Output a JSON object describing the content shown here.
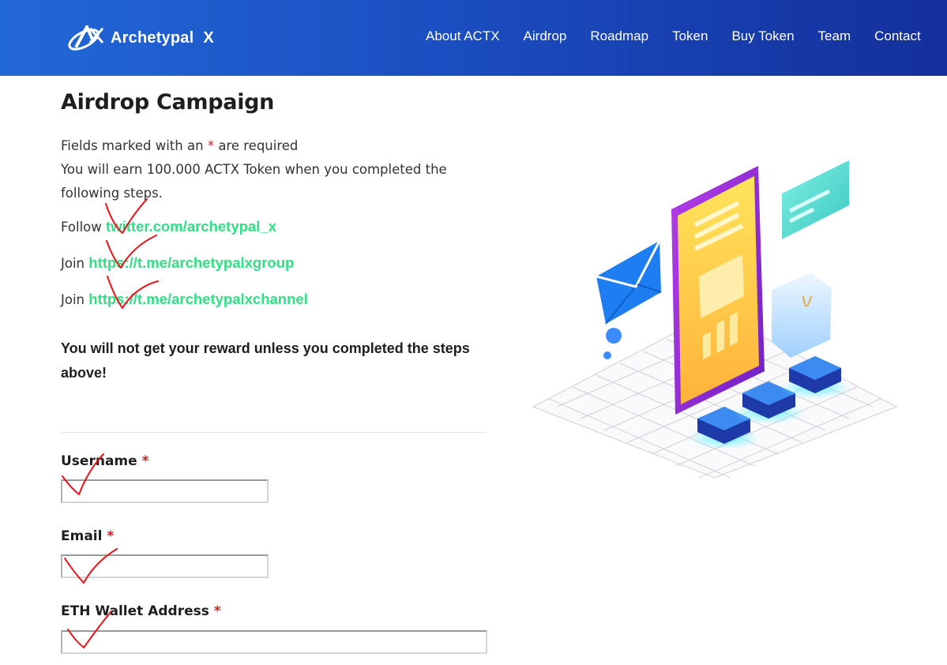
{
  "header": {
    "logo_text": "Archetypal",
    "logo_suffix": "X",
    "nav": [
      {
        "label": "About ACTX"
      },
      {
        "label": "Airdrop"
      },
      {
        "label": "Roadmap"
      },
      {
        "label": "Token"
      },
      {
        "label": "Buy Token"
      },
      {
        "label": "Team"
      },
      {
        "label": "Contact"
      }
    ]
  },
  "main": {
    "title": "Airdrop Campaign",
    "required_prefix": "Fields marked with an",
    "required_star": "*",
    "required_suffix": "are required",
    "earn_text": "You will earn 100.000 ACTX Token when you completed the following steps.",
    "steps": [
      {
        "prefix": "Follow",
        "link": "twitter.com/archetypal_x"
      },
      {
        "prefix": "Join",
        "link": "https://t.me/archetypalxgroup"
      },
      {
        "prefix": "Join",
        "link": "https://t.me/archetypalxchannel"
      }
    ],
    "warning": "You will not get your reward unless you completed the steps above!"
  },
  "form": {
    "required_star": "*",
    "username": {
      "label": "Username",
      "value": ""
    },
    "email": {
      "label": "Email",
      "value": ""
    },
    "eth_wallet": {
      "label": "ETH Wallet Address",
      "value": ""
    }
  },
  "colors": {
    "header_start": "#2268d6",
    "header_end": "#142f9c",
    "link_green": "#2fe084",
    "required_red": "#d61f1f",
    "annotation_red": "#e8141b"
  },
  "illustration": {
    "icons": [
      "phone-icon",
      "envelope-icon",
      "credit-card-icon",
      "shopping-bag-icon",
      "calendar-icon",
      "dollar-icon",
      "image-icon"
    ]
  }
}
